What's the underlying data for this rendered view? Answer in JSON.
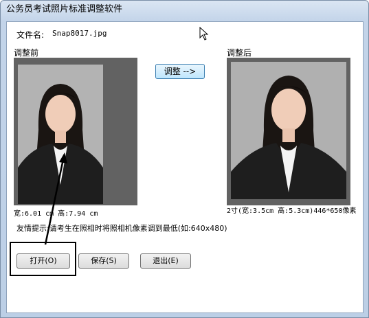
{
  "window": {
    "title": "公务员考试照片标准调整软件"
  },
  "file": {
    "label": "文件名:",
    "name": "Snap8017.jpg"
  },
  "before": {
    "label": "调整前",
    "size_text": "宽:6.01 cm 高:7.94 cm"
  },
  "after": {
    "label": "调整后",
    "size_text": "2寸(宽:3.5cm 高:5.3cm)446*650像素"
  },
  "buttons": {
    "adjust": "调整 -->",
    "open": "打开(O)",
    "save": "保存(S)",
    "exit": "退出(E)"
  },
  "tip": "友情提示:请考生在照相时将照相机像素调到最低(如:640x480)",
  "icons": {
    "cursor": "mouse-pointer-icon",
    "arrow": "annotation-arrow"
  }
}
